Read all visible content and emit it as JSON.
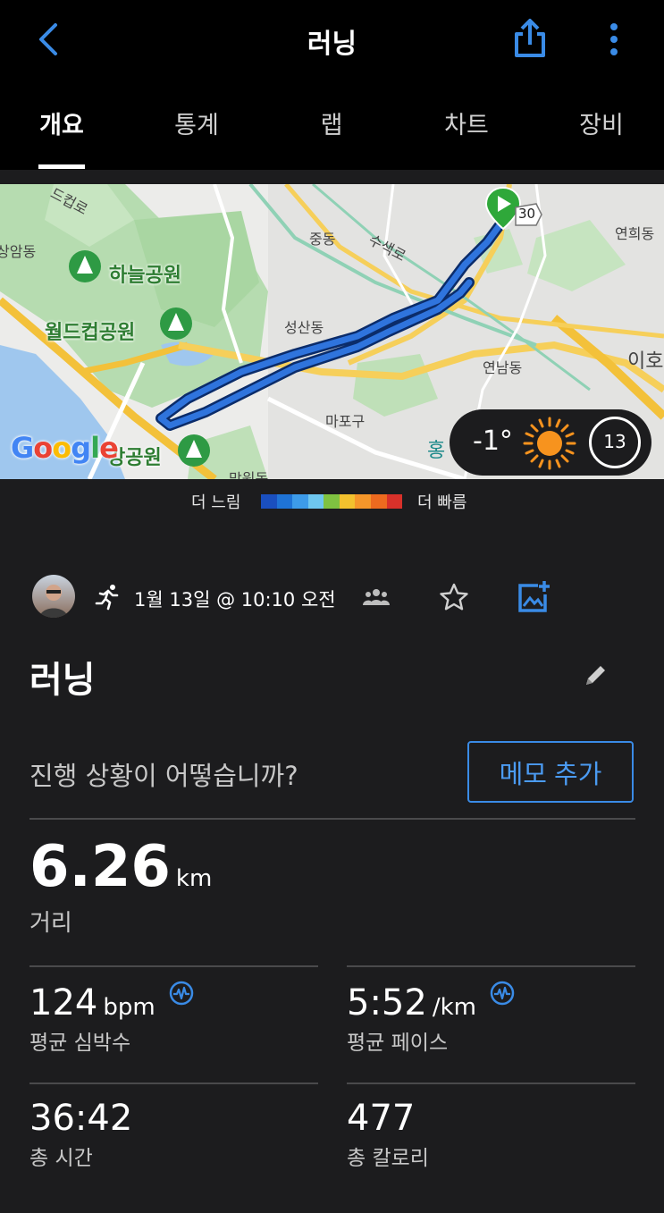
{
  "header": {
    "title": "러닝",
    "back_icon": "chevron-left-icon",
    "share_icon": "share-icon",
    "more_icon": "more-vertical-icon"
  },
  "tabs": [
    {
      "label": "개요",
      "active": true
    },
    {
      "label": "통계",
      "active": false
    },
    {
      "label": "랩",
      "active": false
    },
    {
      "label": "차트",
      "active": false
    },
    {
      "label": "장비",
      "active": false
    }
  ],
  "map": {
    "labels": {
      "l1": "드컵로",
      "l2": "상암동",
      "l3": "하늘공원",
      "l4": "월드컵공원",
      "l5": "중동",
      "l6": "수색로",
      "l7": "성산동",
      "l8": "연남동",
      "l9": "마포구",
      "l10": "연희동",
      "l11": "이호",
      "l12": "망원동",
      "l13": "강공원",
      "l14": "홍"
    },
    "road_sign": "30",
    "attribution": "Google",
    "weather": {
      "temperature": "-1°",
      "condition_icon": "sun-icon",
      "wind_speed": "13"
    }
  },
  "pace_legend": {
    "slow_label": "더 느림",
    "fast_label": "더 빠름",
    "colors": [
      "#1a4fbf",
      "#1f73d6",
      "#3d9be9",
      "#6ec6ef",
      "#7fc241",
      "#f2c12e",
      "#f5962a",
      "#ed6a1f",
      "#d8312a"
    ]
  },
  "activity": {
    "datetime": "1월 13일 @ 10:10 오전",
    "name": "러닝",
    "prompt": "진행 상황이 어떻습니까?",
    "memo_button": "메모 추가"
  },
  "stats": {
    "distance": {
      "value": "6.26",
      "unit": "km",
      "label": "거리"
    },
    "avg_hr": {
      "value": "124",
      "unit": "bpm",
      "label": "평균 심박수"
    },
    "avg_pace": {
      "value": "5:52",
      "unit": "/km",
      "label": "평균 페이스"
    },
    "total_time": {
      "value": "36:42",
      "label": "총 시간"
    },
    "calories": {
      "value": "477",
      "label": "총 칼로리"
    }
  },
  "colors": {
    "accent": "#3a8be6",
    "background": "#1c1c1e",
    "route": "#1f5fd1"
  }
}
